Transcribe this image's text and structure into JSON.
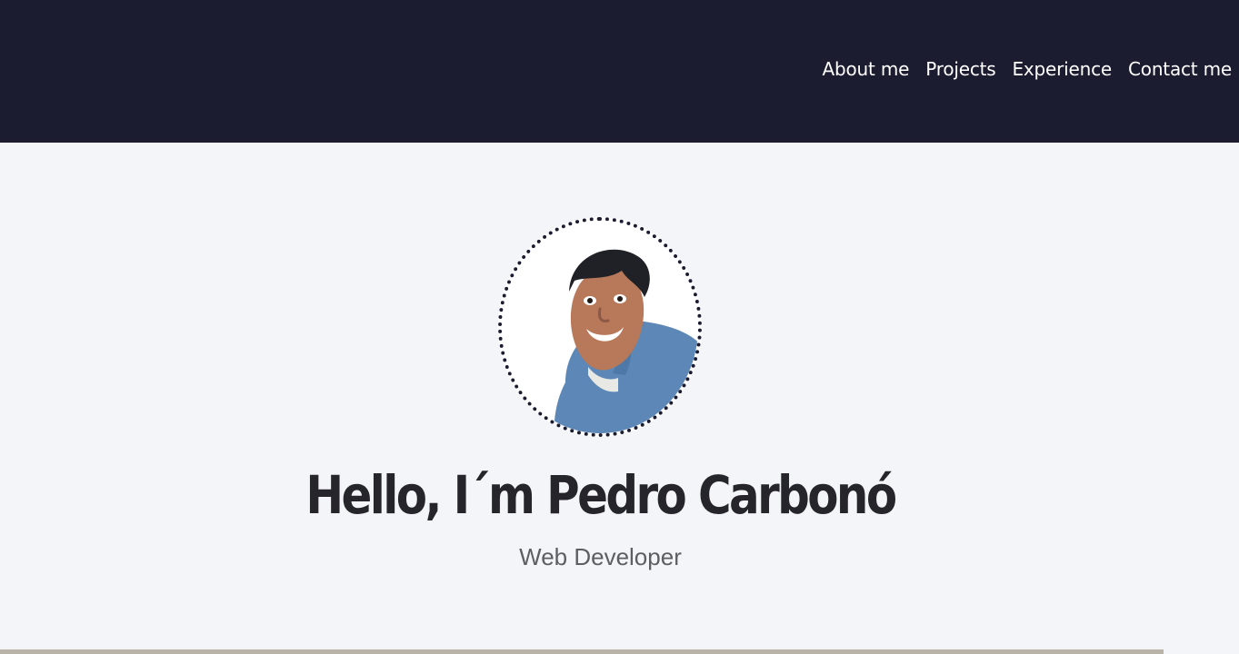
{
  "nav": {
    "links": [
      {
        "label": "About me"
      },
      {
        "label": "Projects"
      },
      {
        "label": "Experience"
      },
      {
        "label": "Contact me"
      }
    ]
  },
  "hero": {
    "title": "Hello, I´m Pedro Carbonó",
    "subtitle": "Web Developer"
  },
  "colors": {
    "navbar_bg": "#1c1c31",
    "page_bg": "#f4f5f8",
    "title_text": "#25252b",
    "subtitle_text": "#5d5d63"
  }
}
